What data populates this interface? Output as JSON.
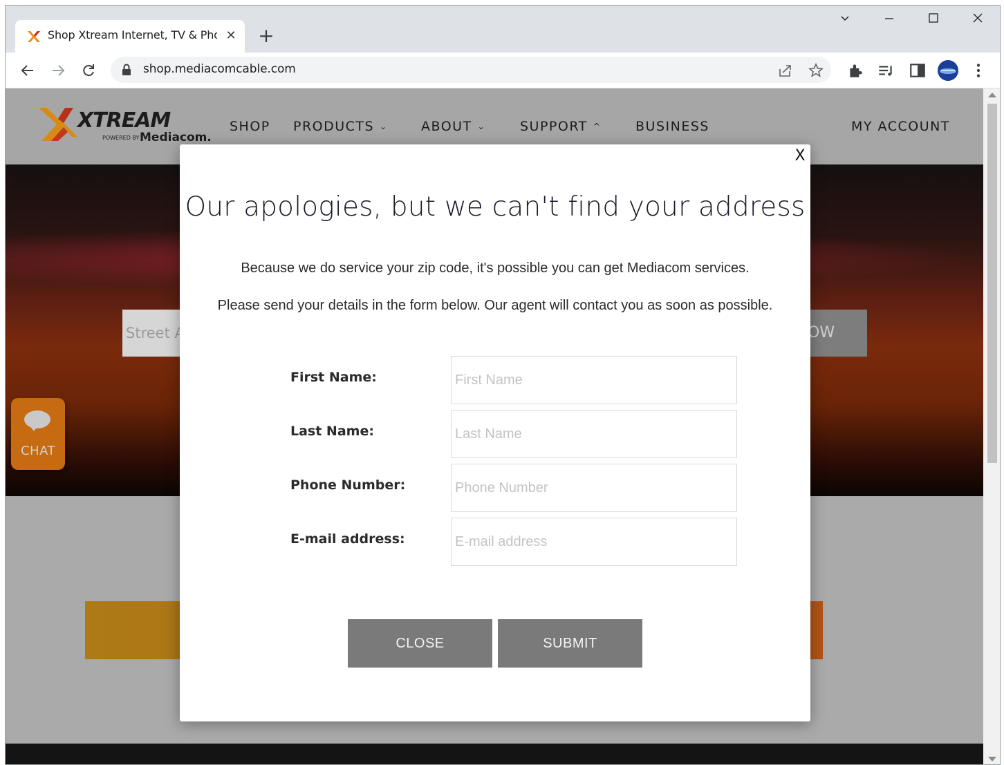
{
  "browser": {
    "tab_title": "Shop Xtream Internet, TV & Phon",
    "tab_close_glyph": "✕",
    "new_tab_glyph": "+",
    "url": "shop.mediacomcable.com"
  },
  "site": {
    "logo_text": "XTREAM",
    "logo_sub_small": "POWERED BY",
    "logo_sub_brand": "Mediacom.",
    "nav": {
      "shop": "SHOP",
      "products": "PRODUCTS",
      "about": "ABOUT",
      "support": "SUPPORT",
      "business": "BUSINESS",
      "my_account": "MY ACCOUNT"
    },
    "hero_input_placeholder": "Street A",
    "hero_button_visible": "OW",
    "chat_label": "CHAT"
  },
  "modal": {
    "close_x": "X",
    "title": "Our apologies, but we can't find your address",
    "line1": "Because we do service your zip code, it's possible you can get Mediacom services.",
    "line2": "Please send your details in the form below. Our agent will contact you as soon as possible.",
    "fields": {
      "first_name_label": "First Name:",
      "first_name_placeholder": "First Name",
      "last_name_label": "Last Name:",
      "last_name_placeholder": "Last Name",
      "phone_label": "Phone Number:",
      "phone_placeholder": "Phone Number",
      "email_label": "E-mail address:",
      "email_placeholder": "E-mail address"
    },
    "close_button": "CLOSE",
    "submit_button": "SUBMIT"
  },
  "colors": {
    "accent_orange": "#c66b12",
    "button_gray": "#7a7a7a"
  }
}
